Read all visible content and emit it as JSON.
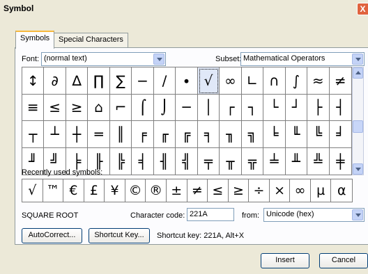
{
  "window": {
    "title": "Symbol",
    "close_label": "X"
  },
  "tabs": [
    {
      "label": "Symbols",
      "hotkey": "S",
      "active": true
    },
    {
      "label": "Special Characters",
      "hotkey": "p",
      "active": false
    }
  ],
  "font": {
    "label": "Font:",
    "hotkey": "F",
    "value": "(normal text)"
  },
  "subset": {
    "label": "Subset:",
    "hotkey": "u",
    "value": "Mathematical Operators"
  },
  "symbols": [
    "↕",
    "∂",
    "∆",
    "∏",
    "∑",
    "−",
    "∕",
    "∙",
    "√",
    "∞",
    "∟",
    "∩",
    "∫",
    "≈",
    "≠",
    "≡",
    "≤",
    "≥",
    "⌂",
    "⌐",
    "⌠",
    "⌡",
    "─",
    "│",
    "┌",
    "┐",
    "└",
    "┘",
    "├",
    "┤",
    "┬",
    "┴",
    "┼",
    "═",
    "║",
    "╒",
    "╓",
    "╔",
    "╕",
    "╖",
    "╗",
    "╘",
    "╙",
    "╚",
    "╛",
    "╜",
    "╝",
    "╞",
    "╟",
    "╠",
    "╡",
    "╢",
    "╣",
    "╤",
    "╥",
    "╦",
    "╧",
    "╨",
    "╩",
    "╪",
    "╫",
    "╬",
    "▀",
    "▄"
  ],
  "selected_symbol_index": 8,
  "recent": {
    "label": "Recently used symbols:",
    "hotkey": "R",
    "symbols": [
      "√",
      "™",
      "€",
      "£",
      "¥",
      "©",
      "®",
      "±",
      "≠",
      "≤",
      "≥",
      "÷",
      "×",
      "∞",
      "µ",
      "α"
    ]
  },
  "char_name": "SQUARE ROOT",
  "char_code": {
    "label": "Character code:",
    "hotkey": "C",
    "value": "221A"
  },
  "from": {
    "label": "from:",
    "hotkey": "m",
    "value": "Unicode (hex)"
  },
  "buttons": {
    "autocorrect": "AutoCorrect...",
    "shortcut_key": "Shortcut Key...",
    "insert": "Insert",
    "cancel": "Cancel"
  },
  "shortcut_text": "Shortcut key: 221A, Alt+X",
  "colors": {
    "dialog_bg": "#ECE9D8",
    "tab_highlight": "#F7B83C",
    "close_button": "#E0633E"
  }
}
